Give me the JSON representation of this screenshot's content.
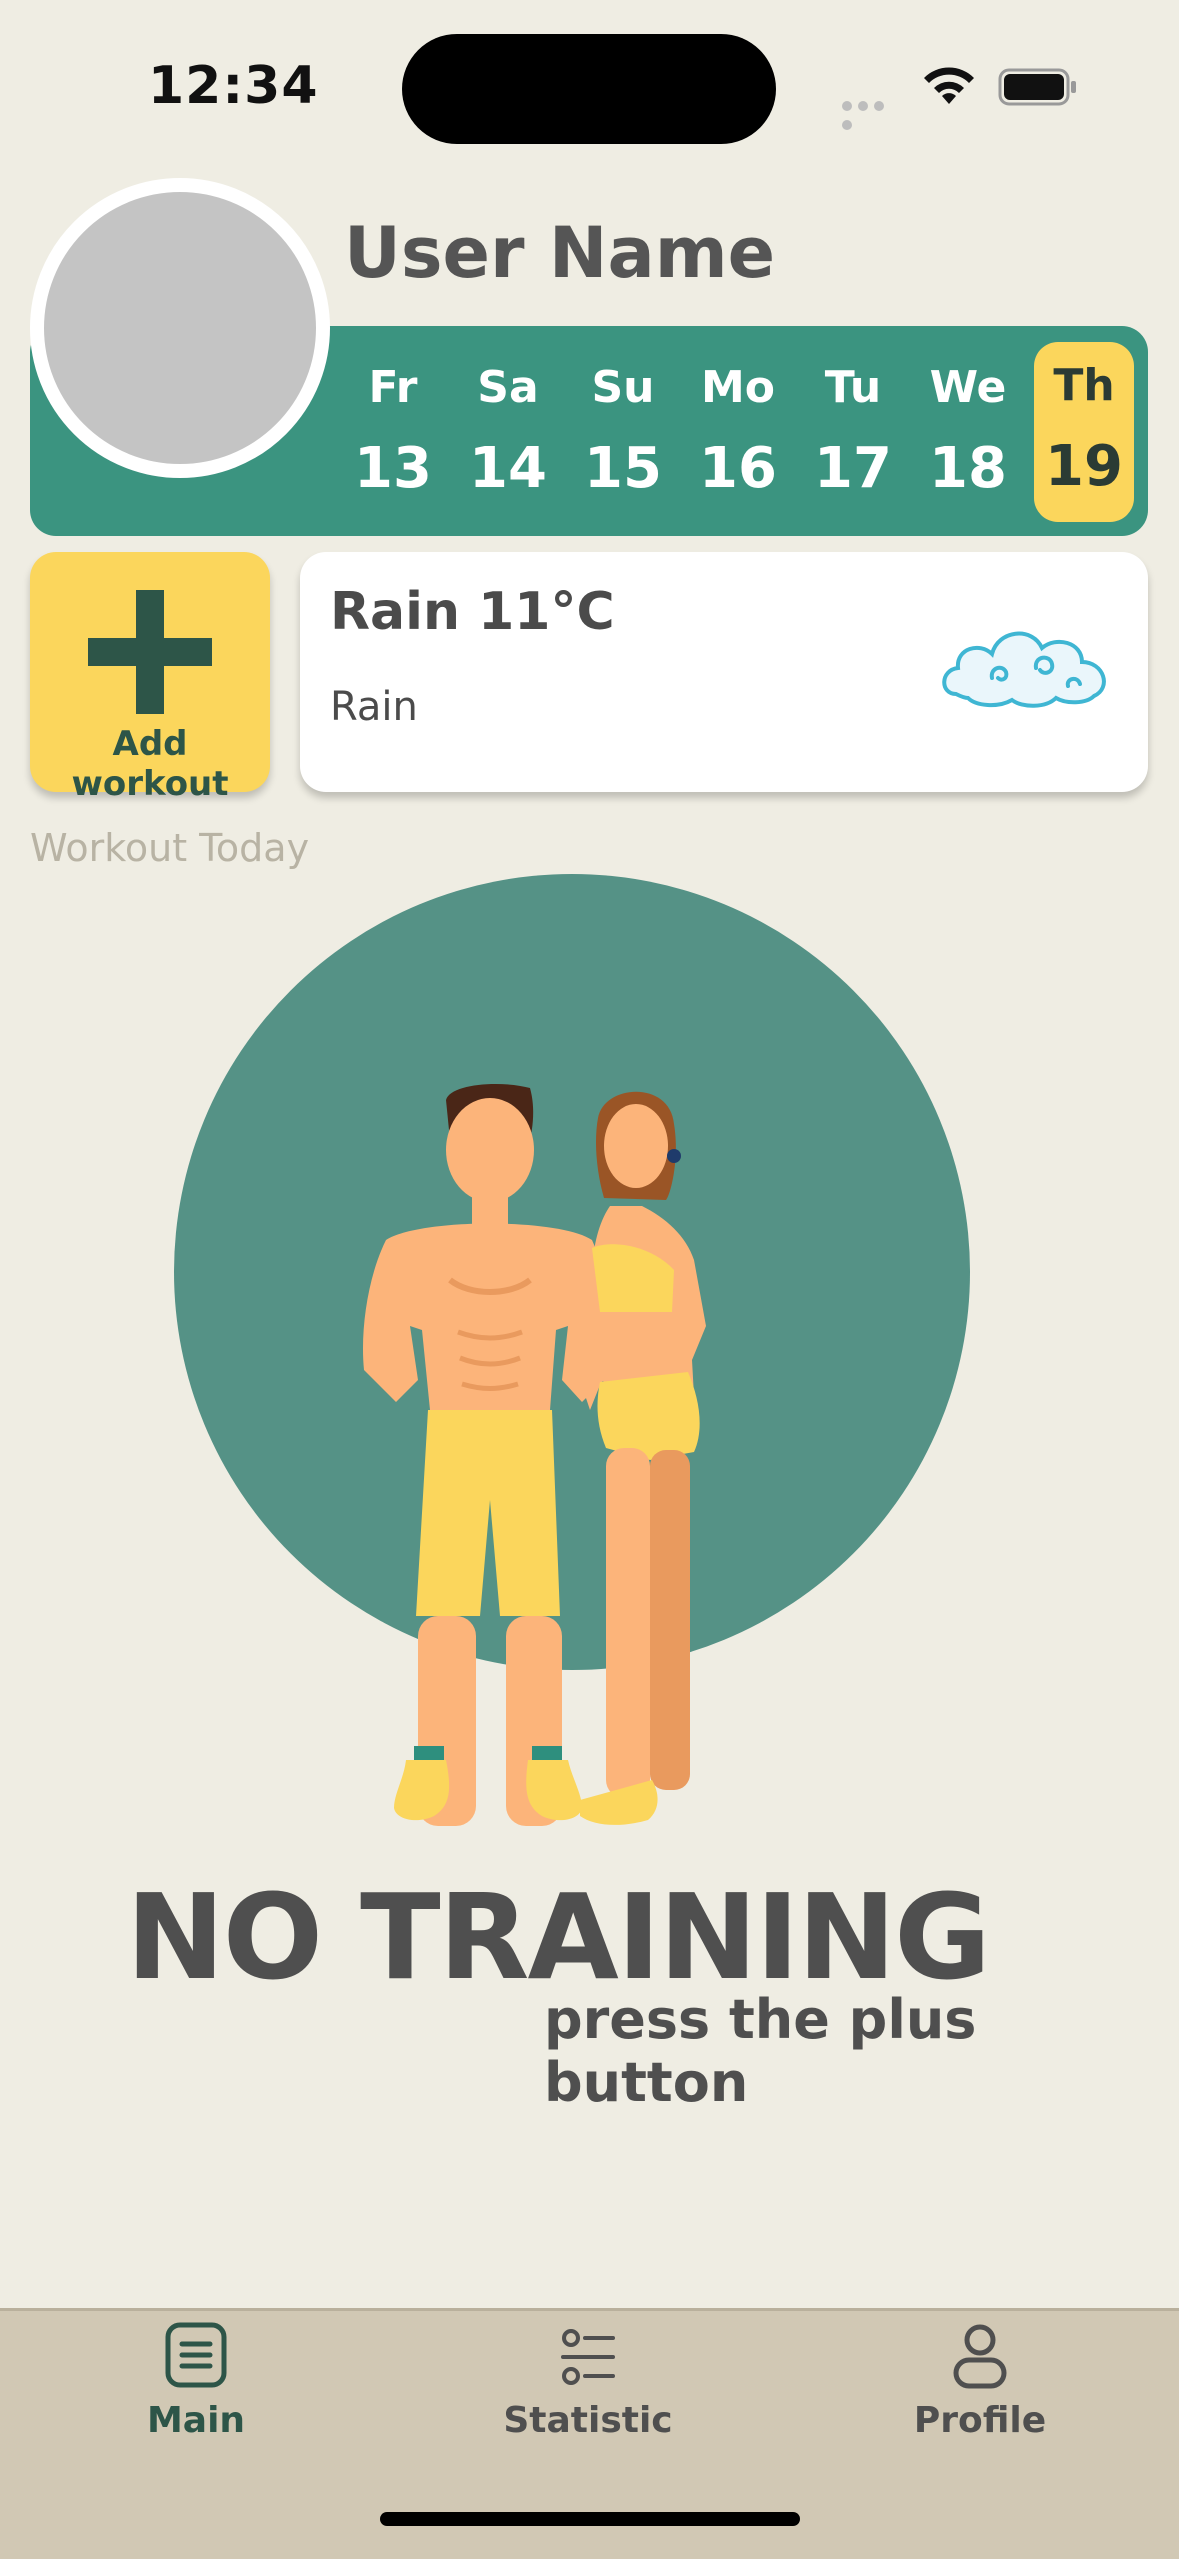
{
  "status_bar": {
    "time": "12:34"
  },
  "header": {
    "user_name": "User Name"
  },
  "week": {
    "days": [
      {
        "name": "Fr",
        "num": "13"
      },
      {
        "name": "Sa",
        "num": "14"
      },
      {
        "name": "Su",
        "num": "15"
      },
      {
        "name": "Mo",
        "num": "16"
      },
      {
        "name": "Tu",
        "num": "17"
      },
      {
        "name": "We",
        "num": "18"
      },
      {
        "name": "Th",
        "num": "19",
        "active": true
      }
    ]
  },
  "add_workout": {
    "label": "Add workout",
    "icon": "plus-icon"
  },
  "weather": {
    "title": "Rain 11°C",
    "condition": "Rain",
    "icon": "cloud-icon"
  },
  "section": {
    "label": "Workout Today"
  },
  "empty_state": {
    "title": "NO TRAINING",
    "hint": "press the plus button"
  },
  "tabs": [
    {
      "label": "Main",
      "icon": "list-icon",
      "active": true
    },
    {
      "label": "Statistic",
      "icon": "sliders-icon"
    },
    {
      "label": "Profile",
      "icon": "person-icon"
    }
  ],
  "colors": {
    "background": "#efede3",
    "accent_green": "#3b9480",
    "accent_yellow": "#fbd65c",
    "dark_green": "#2d5548",
    "tab_bar": "#d1c8b4"
  }
}
